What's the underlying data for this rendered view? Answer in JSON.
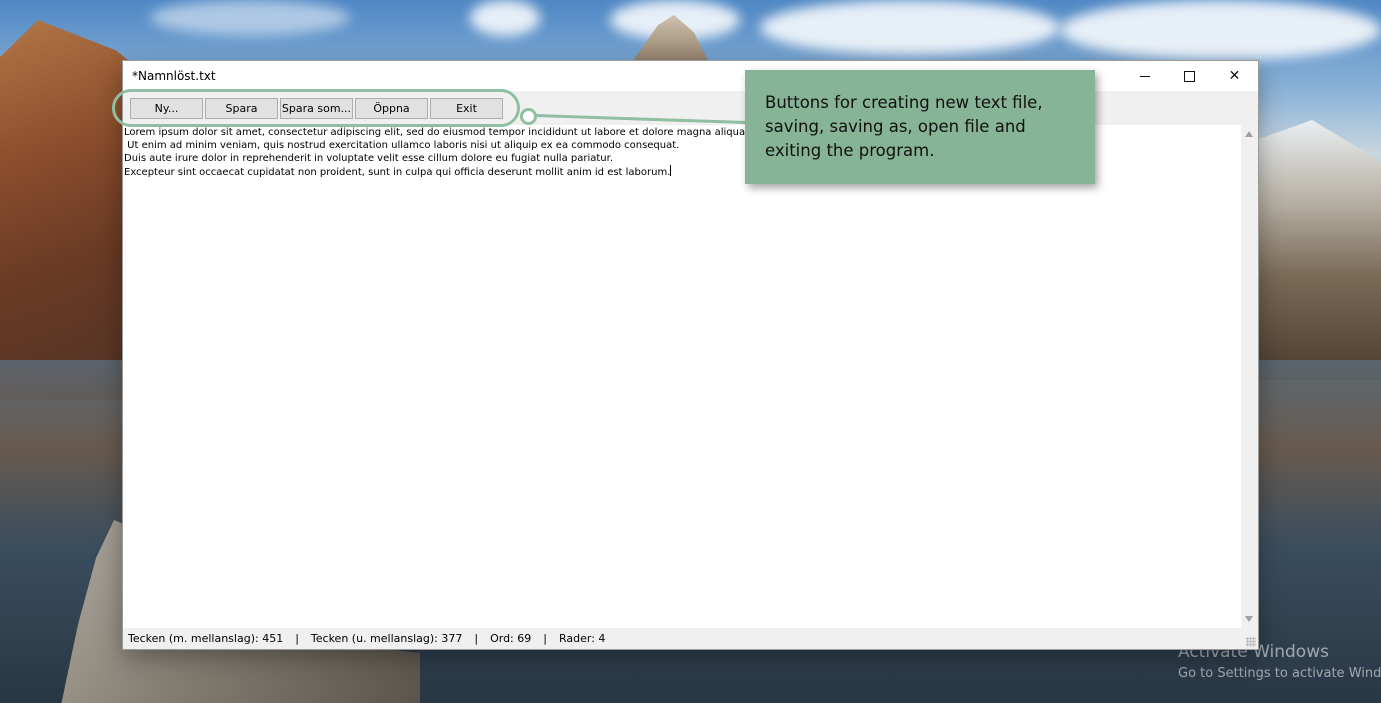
{
  "window": {
    "title": "*Namnlöst.txt",
    "controls": {
      "minimize": "minimize",
      "maximize": "maximize",
      "close": "✕"
    }
  },
  "toolbar": {
    "buttons": [
      {
        "label": "Ny..."
      },
      {
        "label": "Spara"
      },
      {
        "label": "Spara som..."
      },
      {
        "label": "Öppna"
      },
      {
        "label": "Exit"
      }
    ]
  },
  "editor": {
    "lines": [
      "Lorem ipsum dolor sit amet, consectetur adipiscing elit, sed do eiusmod tempor incididunt ut labore et dolore magna aliqua.",
      " Ut enim ad minim veniam, quis nostrud exercitation ullamco laboris nisi ut aliquip ex ea commodo consequat.",
      "Duis aute irure dolor in reprehenderit in voluptate velit esse cillum dolore eu fugiat nulla pariatur.",
      "Excepteur sint occaecat cupidatat non proident, sunt in culpa qui officia deserunt mollit anim id est laborum."
    ]
  },
  "status": {
    "chars_with_spaces": "Tecken (m. mellanslag): 451",
    "chars_without_spaces": "Tecken (u. mellanslag): 377",
    "words": "Ord: 69",
    "lines": "Rader: 4",
    "separator": "|"
  },
  "annotation": {
    "text": "Buttons for creating new text file, saving, saving as, open file and exiting the program."
  },
  "desktop": {
    "watermark_line1": "Activate Windows",
    "watermark_line2": "Go to Settings to activate Windows."
  },
  "colors": {
    "callout_fill": "#87b397",
    "callout_outline": "#8fbfa1",
    "window_background": "#f0f0f0"
  }
}
